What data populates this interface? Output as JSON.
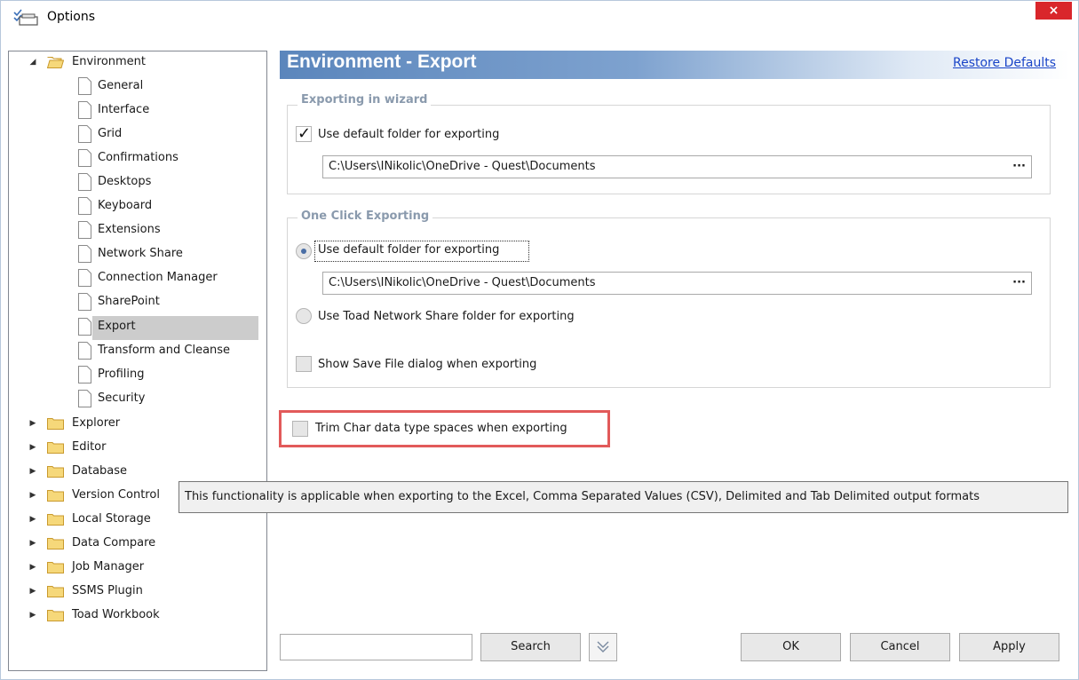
{
  "window": {
    "title": "Options",
    "close_label": "×"
  },
  "tree": {
    "environment": "Environment",
    "environment_children": [
      "General",
      "Interface",
      "Grid",
      "Confirmations",
      "Desktops",
      "Keyboard",
      "Extensions",
      "Network Share",
      "Connection Manager",
      "SharePoint",
      "Export",
      "Transform and Cleanse",
      "Profiling",
      "Security"
    ],
    "selected": "Export",
    "folders": [
      "Explorer",
      "Editor",
      "Database",
      "Version Control",
      "Local Storage",
      "Data Compare",
      "Job Manager",
      "SSMS Plugin",
      "Toad Workbook"
    ]
  },
  "header": {
    "title": "Environment - Export",
    "restore_defaults": "Restore Defaults"
  },
  "wizard_group": {
    "title": "Exporting in wizard",
    "use_default_label": "Use default folder for exporting",
    "use_default_checked": true,
    "path": "C:\\Users\\INikolic\\OneDrive - Quest\\Documents",
    "browse": "···"
  },
  "one_click_group": {
    "title": "One Click Exporting",
    "use_default_label": "Use default folder for exporting",
    "path": "C:\\Users\\INikolic\\OneDrive - Quest\\Documents",
    "browse": "···",
    "network_share_label": "Use Toad Network Share folder for exporting",
    "show_save_label": "Show Save File dialog when exporting"
  },
  "trim_option": {
    "label": "Trim Char data type spaces when exporting",
    "checked": false
  },
  "tooltip": "This functionality is applicable when exporting to the Excel, Comma Separated Values (CSV), Delimited and Tab Delimited output formats",
  "footer": {
    "search_placeholder": "",
    "search_button": "Search",
    "ok": "OK",
    "cancel": "Cancel",
    "apply": "Apply"
  },
  "colors": {
    "accent": "#5b86bc",
    "close": "#d9262b",
    "highlight": "#e25a5a",
    "link": "#1a45c8"
  }
}
